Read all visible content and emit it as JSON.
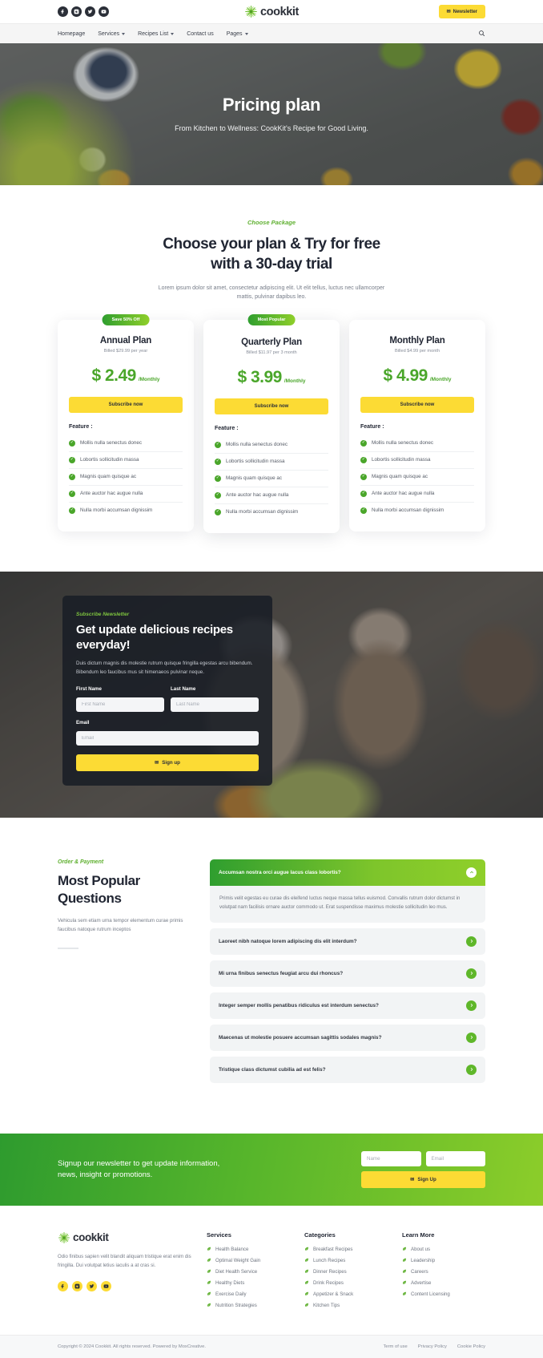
{
  "topbar": {
    "social": [
      {
        "name": "facebook-icon",
        "label": "f"
      },
      {
        "name": "instagram-icon",
        "label": "ig"
      },
      {
        "name": "twitter-icon",
        "label": "t"
      },
      {
        "name": "youtube-icon",
        "label": "yt"
      }
    ],
    "brand": "cookkit",
    "newsletter_button": "Newsletter"
  },
  "nav": {
    "items": [
      {
        "label": "Homepage",
        "has_caret": false
      },
      {
        "label": "Services",
        "has_caret": true
      },
      {
        "label": "Recipes List",
        "has_caret": true
      },
      {
        "label": "Contact us",
        "has_caret": false
      },
      {
        "label": "Pages",
        "has_caret": true
      }
    ],
    "search_icon": "search-icon"
  },
  "hero": {
    "title": "Pricing plan",
    "subtitle": "From Kitchen to Wellness: CookKit's Recipe for Good Living."
  },
  "pricing": {
    "eyebrow": "Choose Package",
    "title_line1": "Choose your plan & Try for free",
    "title_line2": "with a 30-day trial",
    "description": "Lorem ipsum dolor sit amet, consectetur adipiscing elit. Ut elit tellus, luctus nec ullamcorper mattis, pulvinar dapibus leo.",
    "feature_label": "Feature :",
    "plans": [
      {
        "badge": "Save 50% Off",
        "name": "Annual Plan",
        "billed": "Billed $29.99 per year",
        "price": "$ 2.49",
        "period": "/Monthly",
        "cta": "Subscribe now",
        "features": [
          "Mollis nulla senectus donec",
          "Lobortis sollicitudin massa",
          "Magnis quam quisque ac",
          "Ante auctor hac augue nulla",
          "Nulla morbi accumsan dignissim"
        ]
      },
      {
        "badge": "Most Popular",
        "name": "Quarterly Plan",
        "billed": "Billed $11.97 per 3 month",
        "price": "$ 3.99",
        "period": "/Monthly",
        "cta": "Subscribe now",
        "features": [
          "Mollis nulla senectus donec",
          "Lobortis sollicitudin massa",
          "Magnis quam quisque ac",
          "Ante auctor hac augue nulla",
          "Nulla morbi accumsan dignissim"
        ]
      },
      {
        "badge": "",
        "name": "Monthly Plan",
        "billed": "Billed $4.99 per month",
        "price": "$ 4.99",
        "period": "/Monthly",
        "cta": "Subscribe now",
        "features": [
          "Mollis nulla senectus donec",
          "Lobortis sollicitudin massa",
          "Magnis quam quisque ac",
          "Ante auctor hac augue nulla",
          "Nulla morbi accumsan dignissim"
        ]
      }
    ]
  },
  "subscribe": {
    "eyebrow": "Subscribe Newsletter",
    "title": "Get update delicious recipes everyday!",
    "description": "Duis dictum magnis dis molestie rutrum quisque fringilla egestas arcu bibendum. Bibendum leo faucibus mus sit himenaeos pulvinar neque.",
    "first_name_label": "First Name",
    "first_name_placeholder": "First Name",
    "first_name_value": "",
    "last_name_label": "Last Name",
    "last_name_placeholder": "Last Name",
    "last_name_value": "",
    "email_label": "Email",
    "email_placeholder": "Email",
    "email_value": "",
    "signup_button": "Sign up"
  },
  "faq": {
    "eyebrow": "Order & Payment",
    "title": "Most Popular Questions",
    "description": "Vehicula sem etiam urna tempor elementum curae primis faucibus natoque rutrum inceptos",
    "items": [
      {
        "question": "Accumsan nostra orci augue lacus class lobortis?",
        "open": true,
        "answer": "Primis velit egestas eu curae dis eleifend luctus neque massa tellus euismod. Convallis rutrum dolor dictumst in volutpat nam facilisis ornare auctor commodo ut. Erat suspendisse maximus molestie sollicitudin leo mus."
      },
      {
        "question": "Laoreet nibh natoque lorem adipiscing dis elit interdum?",
        "open": false,
        "answer": ""
      },
      {
        "question": "Mi urna finibus senectus feugiat arcu dui rhoncus?",
        "open": false,
        "answer": ""
      },
      {
        "question": "Integer semper mollis penatibus ridiculus est interdum senectus?",
        "open": false,
        "answer": ""
      },
      {
        "question": "Maecenas ut molestie posuere accumsan sagittis sodales magnis?",
        "open": false,
        "answer": ""
      },
      {
        "question": "Tristique class dictumst cubilia ad est felis?",
        "open": false,
        "answer": ""
      }
    ]
  },
  "cta": {
    "text_line1": "Signup our newsletter to get update information,",
    "text_line2": "news, insight or promotions.",
    "name_placeholder": "Name",
    "name_value": "",
    "email_placeholder": "Email",
    "email_value": "",
    "button": "Sign Up"
  },
  "footer": {
    "brand": "cookkit",
    "description": "Odio finibus sapien velit blandit aliquam tristique erat enim dis fringilla. Dui volutpat letius iaculis a at cras si.",
    "social": [
      {
        "name": "facebook-icon"
      },
      {
        "name": "instagram-icon"
      },
      {
        "name": "twitter-icon"
      },
      {
        "name": "youtube-icon"
      }
    ],
    "columns": [
      {
        "title": "Services",
        "links": [
          "Health Balance",
          "Optimal Weight Gain",
          "Diet Health Service",
          "Healthy Diets",
          "Exercise Daily",
          "Nutrition Strategies"
        ]
      },
      {
        "title": "Categories",
        "links": [
          "Breakfast Recipes",
          "Lunch Recipes",
          "Dinner Recipes",
          "Drink Recipes",
          "Appetizer & Snack",
          "Kitchen Tips"
        ]
      },
      {
        "title": "Learn More",
        "links": [
          "About us",
          "Leadership",
          "Careers",
          "Advertise",
          "Content Licensing"
        ]
      }
    ]
  },
  "bottombar": {
    "copyright": "Copyright © 2024 Cookkit. All rights reserved. Powered by MoxCreative.",
    "legal": [
      "Term of use",
      "Privacy Policy",
      "Cookie Policy"
    ]
  },
  "colors": {
    "brand_green": "#5fb030",
    "accent_yellow": "#fcdb34",
    "dark": "#212633",
    "price_green": "#4aa62a"
  }
}
